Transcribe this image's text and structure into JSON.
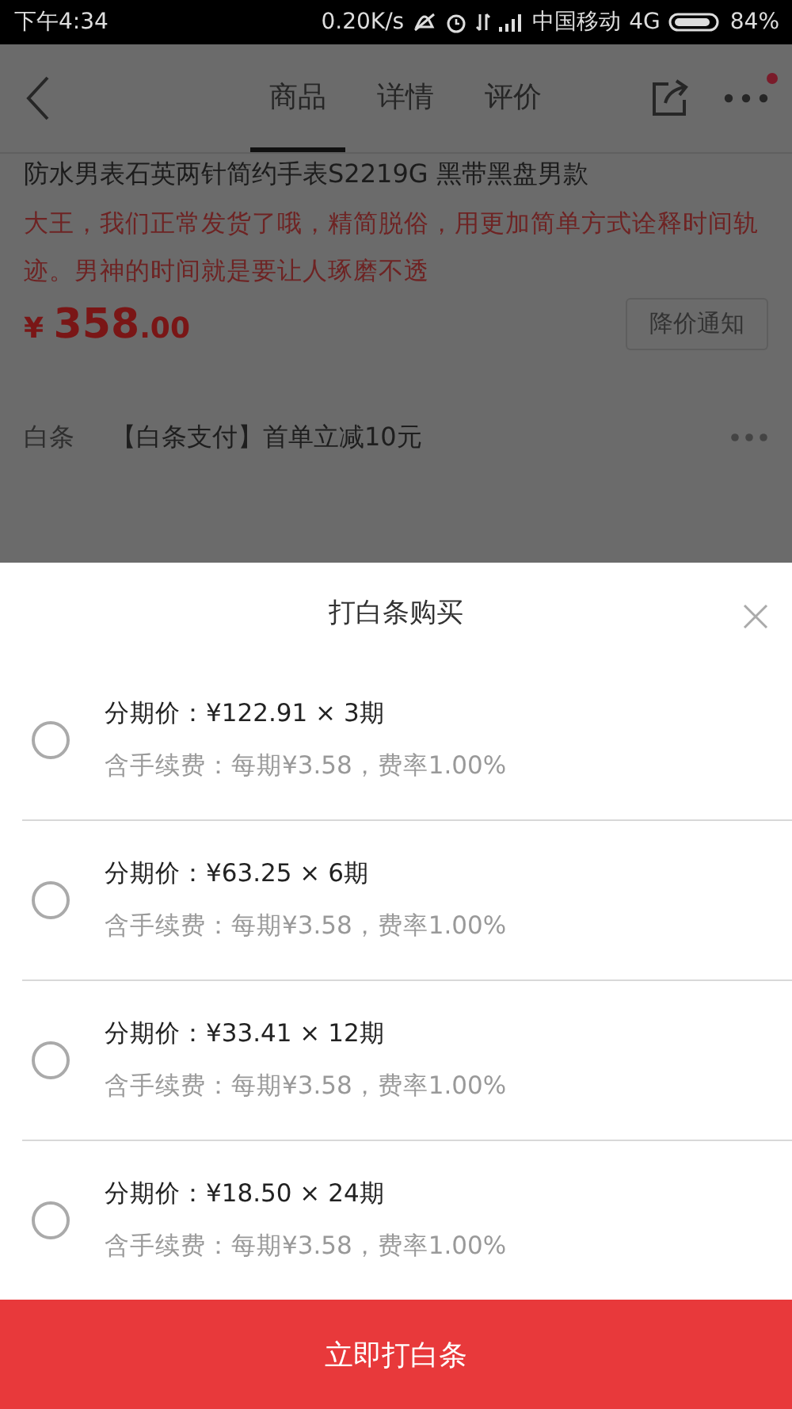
{
  "status_bar": {
    "time": "下午4:34",
    "speed": "0.20K/s",
    "carrier": "中国移动",
    "network": "4G",
    "battery": "84%"
  },
  "nav": {
    "tabs": [
      {
        "label": "商品",
        "selected": true
      },
      {
        "label": "详情",
        "selected": false
      },
      {
        "label": "评价",
        "selected": false
      }
    ],
    "has_notification": true
  },
  "product": {
    "title": "防水男表石英两针简约手表S2219G 黑带黑盘男款",
    "slogan": "大王，我们正常发货了哦，精简脱俗，用更加简单方式诠释时间轨迹。男神的时间就是要让人琢磨不透",
    "currency": "¥",
    "price_int": "358",
    "price_dec": ".00",
    "notify_button": "降价通知"
  },
  "baitiao": {
    "label": "白条",
    "text": "【白条支付】首单立减10元"
  },
  "sheet": {
    "title": "打白条购买",
    "options": [
      {
        "price": "分期价：¥122.91 × 3期",
        "fee": "含手续费：每期¥3.58，费率1.00%",
        "selected": false
      },
      {
        "price": "分期价：¥63.25 × 6期",
        "fee": "含手续费：每期¥3.58，费率1.00%",
        "selected": false
      },
      {
        "price": "分期价：¥33.41 × 12期",
        "fee": "含手续费：每期¥3.58，费率1.00%",
        "selected": false
      },
      {
        "price": "分期价：¥18.50 × 24期",
        "fee": "含手续费：每期¥3.58，费率1.00%",
        "selected": false
      }
    ],
    "confirm_button": "立即打白条"
  }
}
